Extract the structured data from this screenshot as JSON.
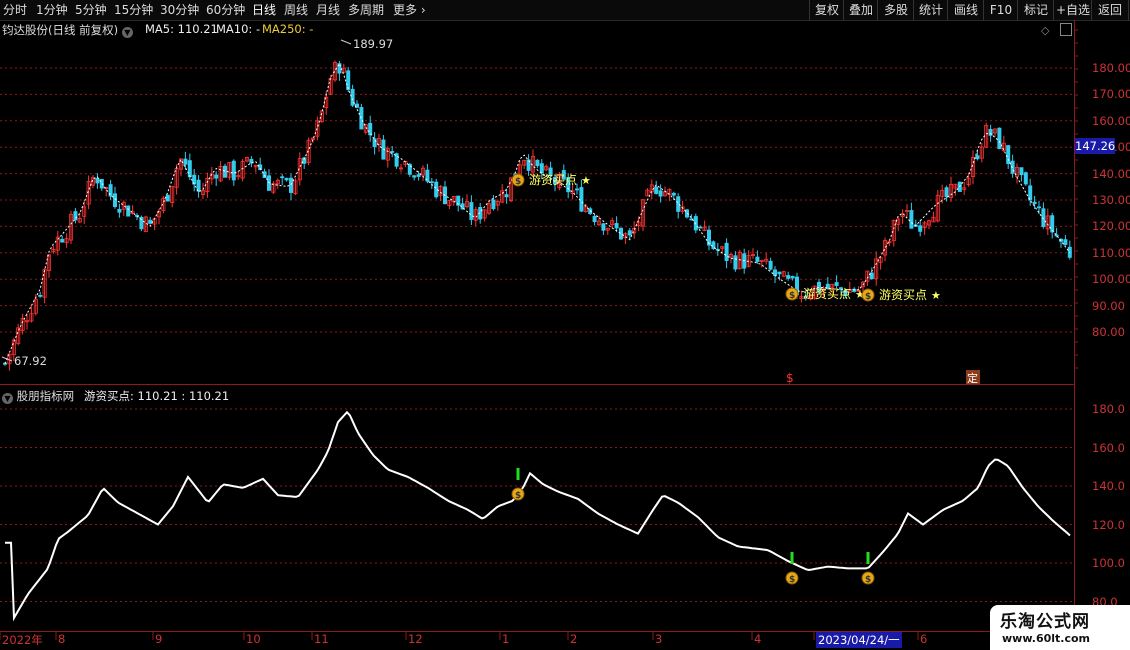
{
  "toolbar": {
    "left_items": [
      "分时",
      "1分钟",
      "5分钟",
      "15分钟",
      "30分钟",
      "60分钟",
      "日线",
      "周线",
      "月线",
      "多周期",
      "更多"
    ],
    "active": "日线",
    "right_items": [
      "复权",
      "叠加",
      "多股",
      "统计",
      "画线",
      "F10",
      "标记",
      "+自选",
      "返回"
    ]
  },
  "main_chart": {
    "title": "钧达股份(日线 前复权)",
    "ma5_label": "MA5: 110.21",
    "ma10_label": "MA10: -",
    "ma250_label": "MA250: -",
    "y_ticks": [
      "180.00",
      "170.00",
      "160.00",
      "150.00",
      "140.00",
      "130.00",
      "120.00",
      "110.00",
      "100.00",
      "90.00",
      "80.00"
    ],
    "high_label": "189.97",
    "low_label": "67.92",
    "current_price": "147.26",
    "signal_label": "游资买点",
    "signal_star": "★",
    "bottom_marks": [
      "$",
      "定"
    ]
  },
  "sub_chart": {
    "title": "股朋指标网",
    "indicator_label": "游资买点: 110.21 : 110.21",
    "y_ticks": [
      "180.0",
      "160.0",
      "140.0",
      "120.0",
      "100.0",
      "80.0"
    ]
  },
  "date_axis": {
    "labels": [
      "2022年",
      "8",
      "9",
      "10",
      "11",
      "12",
      "1",
      "2",
      "3",
      "4",
      "2023/04/24/一",
      "6"
    ]
  },
  "watermark": {
    "title": "乐淘公式网",
    "url": "www.60lt.com"
  },
  "colors": {
    "up": "#ff3333",
    "down": "#33ccee",
    "grid": "#8b1a1a",
    "signal": "#ffff66",
    "line": "#ffffff"
  }
}
